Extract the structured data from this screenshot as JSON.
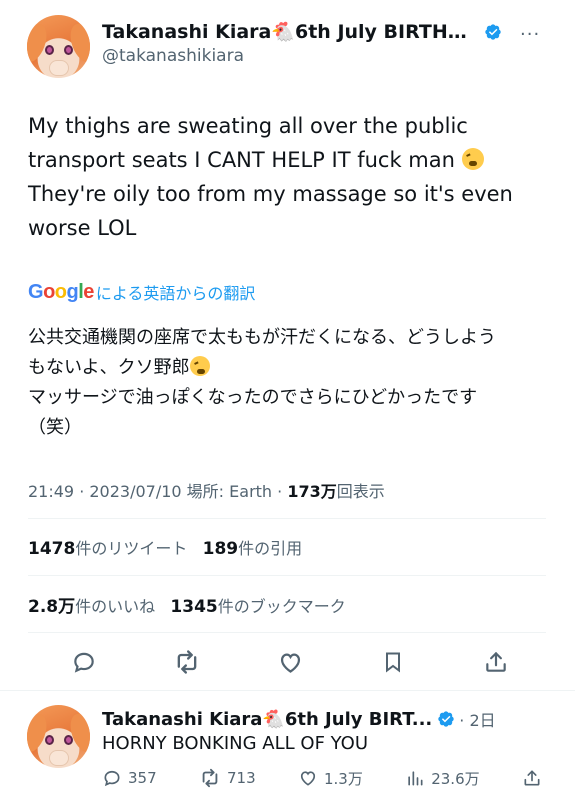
{
  "tweet": {
    "display_name": "Takanashi Kiara🐔6th July BIRTHDA...",
    "handle": "@takanashikiara",
    "more": "···",
    "text_line1": "My thighs are sweating all over the public",
    "text_line2": "transport seats I CANT HELP IT fuck man",
    "text_line3": "They're oily too from my massage so it's even",
    "text_line4": "worse LOL",
    "translate_label": "による英語からの翻訳",
    "google_logo": "Google",
    "translated_line1": "公共交通機関の座席で太ももが汗だくになる、どうしよう",
    "translated_line2": "もないよ、クソ野郎",
    "translated_line3": "マッサージで油っぽくなったのでさらにひどかったです",
    "translated_line4": "（笑）",
    "time": "21:49 · 2023/07/10 場所: Earth · ",
    "views_count": "173万",
    "views_label": "回表示",
    "retweets_count": "1478",
    "retweets_label": "件のリツイート",
    "quotes_count": "189",
    "quotes_label": "件の引用",
    "likes_count": "2.8万",
    "likes_label": "件のいいね",
    "bookmarks_count": "1345",
    "bookmarks_label": "件のブックマーク"
  },
  "reply": {
    "display_name": "Takanashi Kiara🐔6th July BIRT...",
    "time": "· 2日",
    "text": "HORNY BONKING ALL OF YOU",
    "replies": "357",
    "retweets": "713",
    "likes": "1.3万",
    "views": "23.6万"
  },
  "colors": {
    "accent": "#1d9bf0",
    "text": "#0f1419",
    "secondary": "#536471",
    "divider": "#eff3f4"
  },
  "icons": [
    "verified-badge-icon",
    "more-icon",
    "reply-icon",
    "retweet-icon",
    "like-icon",
    "bookmark-icon",
    "share-icon",
    "views-icon"
  ]
}
